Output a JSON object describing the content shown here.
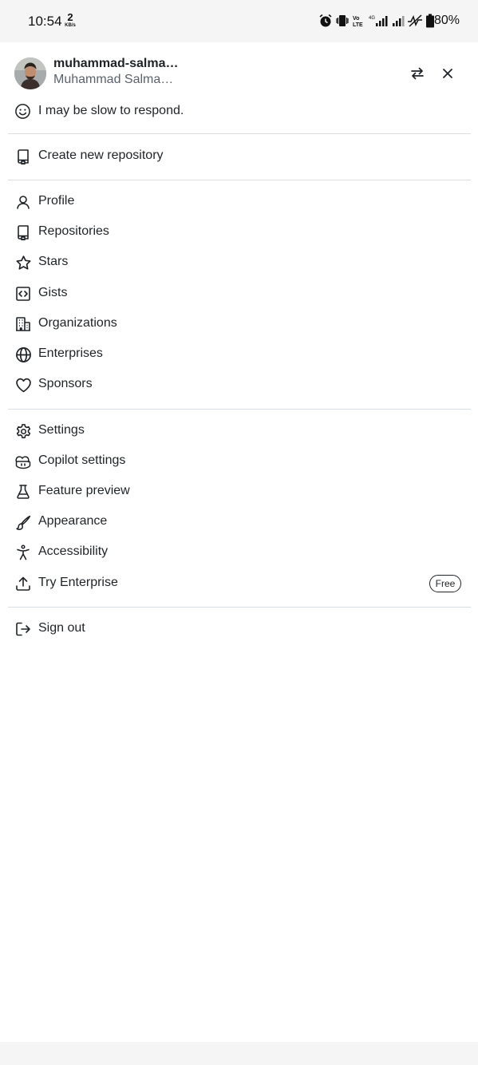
{
  "status_bar": {
    "time": "10:54",
    "net_speed_value": "2",
    "net_speed_unit": "KB/s",
    "battery": "80%",
    "icons": [
      "alarm-icon",
      "vibrate-icon",
      "volte-icon",
      "signal-icon",
      "signal-icon",
      "no-data-icon",
      "battery-icon"
    ]
  },
  "header": {
    "username": "muhammad-salma…",
    "full_name": "Muhammad Salma…",
    "status": "I may be slow to respond."
  },
  "menu": {
    "create": {
      "label": "Create new repository",
      "icon": "repo-icon"
    },
    "items": [
      {
        "label": "Profile",
        "icon": "person-icon"
      },
      {
        "label": "Repositories",
        "icon": "repo-icon"
      },
      {
        "label": "Stars",
        "icon": "star-icon"
      },
      {
        "label": "Gists",
        "icon": "code-square-icon"
      },
      {
        "label": "Organizations",
        "icon": "organization-icon"
      },
      {
        "label": "Enterprises",
        "icon": "globe-icon"
      },
      {
        "label": "Sponsors",
        "icon": "heart-icon"
      }
    ],
    "settings_items": [
      {
        "label": "Settings",
        "icon": "gear-icon"
      },
      {
        "label": "Copilot settings",
        "icon": "copilot-icon"
      },
      {
        "label": "Feature preview",
        "icon": "beaker-icon"
      },
      {
        "label": "Appearance",
        "icon": "paintbrush-icon"
      },
      {
        "label": "Accessibility",
        "icon": "accessibility-icon"
      },
      {
        "label": "Try Enterprise",
        "icon": "upload-icon",
        "badge": "Free"
      }
    ],
    "sign_out": {
      "label": "Sign out",
      "icon": "sign-out-icon"
    }
  },
  "colors": {
    "text": "#1f2328",
    "muted": "#59636e",
    "divider": "#d8dee4"
  }
}
